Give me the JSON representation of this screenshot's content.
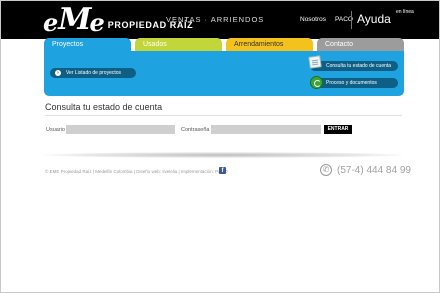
{
  "header": {
    "logo_e": "e",
    "logo_m": "M",
    "logo_e2": "e",
    "brand": "PROPIEDAD RAÍZ",
    "tagline": "VENTAS · ARRIENDOS",
    "nav": [
      "Nosotros",
      "PACO"
    ],
    "ayuda": "Ayuda",
    "ayuda_sub": "en línea"
  },
  "tabs": [
    "Proyectos",
    "Usados",
    "Arrendamientos",
    "Contacto"
  ],
  "panel": {
    "left_link": "Ver Listado de proyectos",
    "right_links": [
      "Consulta tu estado de cuenta",
      "Proceso y documentos"
    ]
  },
  "main": {
    "title": "Consulta tu estado de cuenta",
    "user_label": "Usuario",
    "pass_label": "Contraseña",
    "user_value": "",
    "pass_value": "",
    "enter_label": "ENTRAR"
  },
  "footer": {
    "text": "© EME Propiedad Raíz | Medellín Colombia | Diseño web: svelelia | Implementación: PACO",
    "fb": "f",
    "phone": "(57-4) 444 84 99"
  },
  "colors": {
    "tab_proyectos": "#1fa2e0",
    "tab_usados": "#c2d63a",
    "tab_arrendamientos": "#f4c21c",
    "tab_contacto": "#9c9c9c",
    "header_bg": "#000000"
  },
  "icons": [
    "arrow-right-icon",
    "document-icon",
    "process-icon",
    "facebook-icon",
    "phone-icon"
  ]
}
